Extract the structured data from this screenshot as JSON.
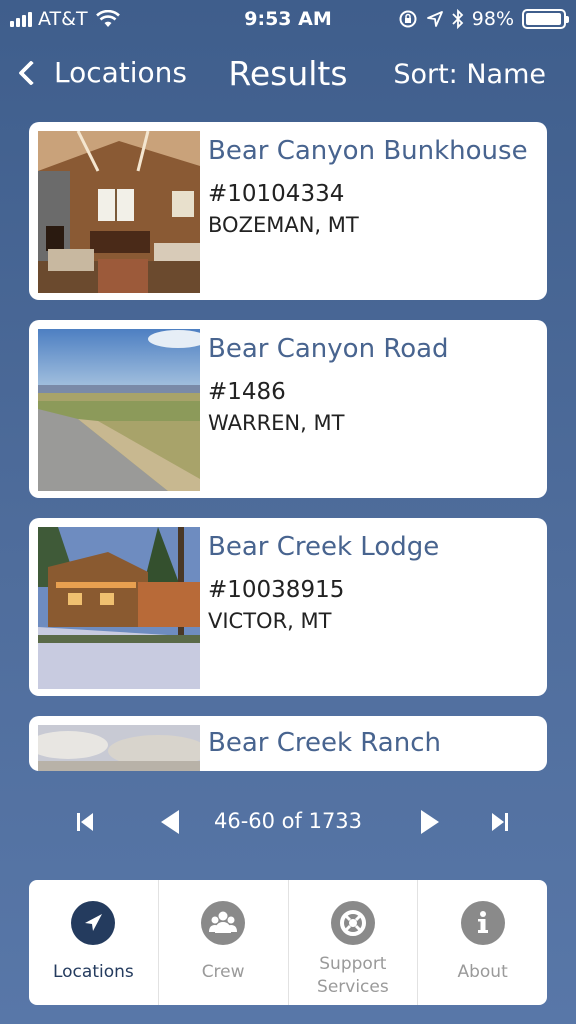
{
  "status_bar": {
    "carrier": "AT&T",
    "time": "9:53 AM",
    "battery": "98%",
    "battery_level": 0.98
  },
  "nav": {
    "back_label": "Locations",
    "title": "Results",
    "sort_label": "Sort: Name"
  },
  "results": [
    {
      "title": "Bear Canyon Bunkhouse",
      "id": "#10104334",
      "location": "BOZEMAN, MT"
    },
    {
      "title": "Bear Canyon Road",
      "id": "#1486",
      "location": "WARREN, MT"
    },
    {
      "title": "Bear Creek Lodge",
      "id": "#10038915",
      "location": "VICTOR, MT"
    },
    {
      "title": "Bear Creek Ranch"
    }
  ],
  "pagination": {
    "label": "46-60 of 1733",
    "icons": [
      "first-page-icon",
      "previous-page-icon",
      "next-page-icon",
      "last-page-icon"
    ]
  },
  "tabs": [
    {
      "label": "Locations",
      "icon": "location-arrow-icon",
      "active": true
    },
    {
      "label": "Crew",
      "icon": "people-icon",
      "active": false
    },
    {
      "label": "Support\nServices",
      "icon": "lifebuoy-icon",
      "active": false
    },
    {
      "label": "About",
      "icon": "info-icon",
      "active": false
    }
  ],
  "colors": {
    "background": "#4a6898",
    "title_text": "#48648f",
    "active_tab": "#243b5e",
    "inactive_tab": "#9a9a9a"
  }
}
